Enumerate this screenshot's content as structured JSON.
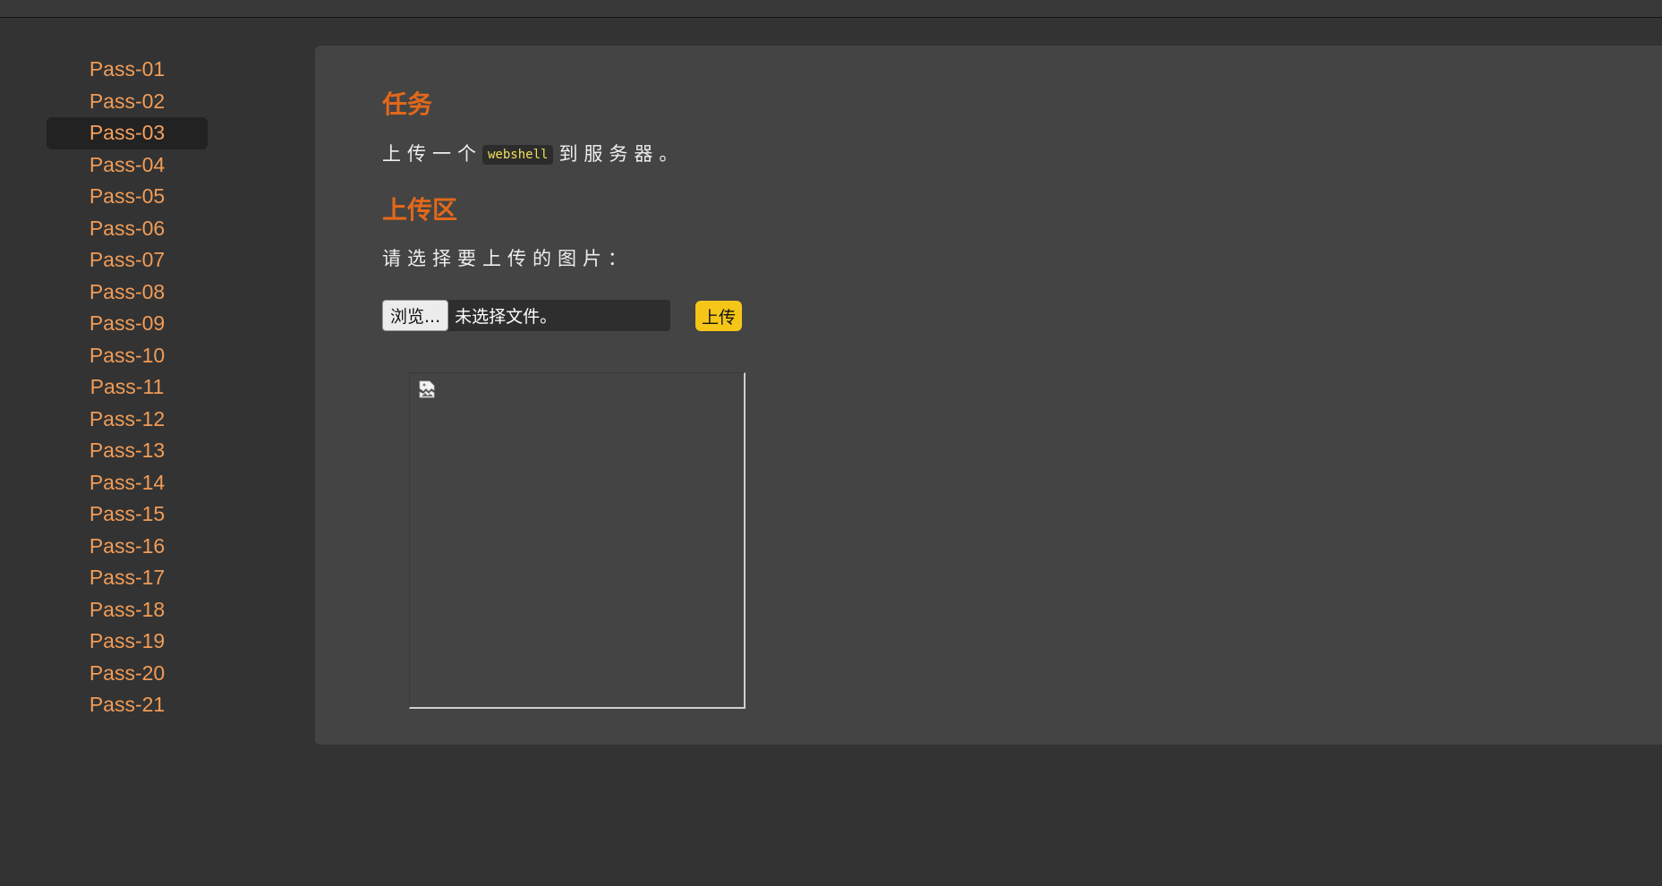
{
  "sidebar": {
    "items": [
      {
        "label": "Pass-01"
      },
      {
        "label": "Pass-02"
      },
      {
        "label": "Pass-03",
        "active": true
      },
      {
        "label": "Pass-04"
      },
      {
        "label": "Pass-05"
      },
      {
        "label": "Pass-06"
      },
      {
        "label": "Pass-07"
      },
      {
        "label": "Pass-08"
      },
      {
        "label": "Pass-09"
      },
      {
        "label": "Pass-10"
      },
      {
        "label": "Pass-11"
      },
      {
        "label": "Pass-12"
      },
      {
        "label": "Pass-13"
      },
      {
        "label": "Pass-14"
      },
      {
        "label": "Pass-15"
      },
      {
        "label": "Pass-16"
      },
      {
        "label": "Pass-17"
      },
      {
        "label": "Pass-18"
      },
      {
        "label": "Pass-19"
      },
      {
        "label": "Pass-20"
      },
      {
        "label": "Pass-21"
      }
    ]
  },
  "task": {
    "heading": "任务",
    "text_before": "上传一个",
    "code": "webshell",
    "text_after": "到服务器。"
  },
  "upload": {
    "heading": "上传区",
    "prompt": "请选择要上传的图片：",
    "browse_label": "浏览...",
    "file_status": "未选择文件。",
    "submit_label": "上传"
  },
  "preview": {
    "icon": "broken-image-icon"
  },
  "colors": {
    "background": "#333333",
    "panel": "#444444",
    "nav_link": "#f19c57",
    "heading": "#e2681a",
    "upload_button": "#f5c518",
    "code_text": "#f1e05a"
  }
}
